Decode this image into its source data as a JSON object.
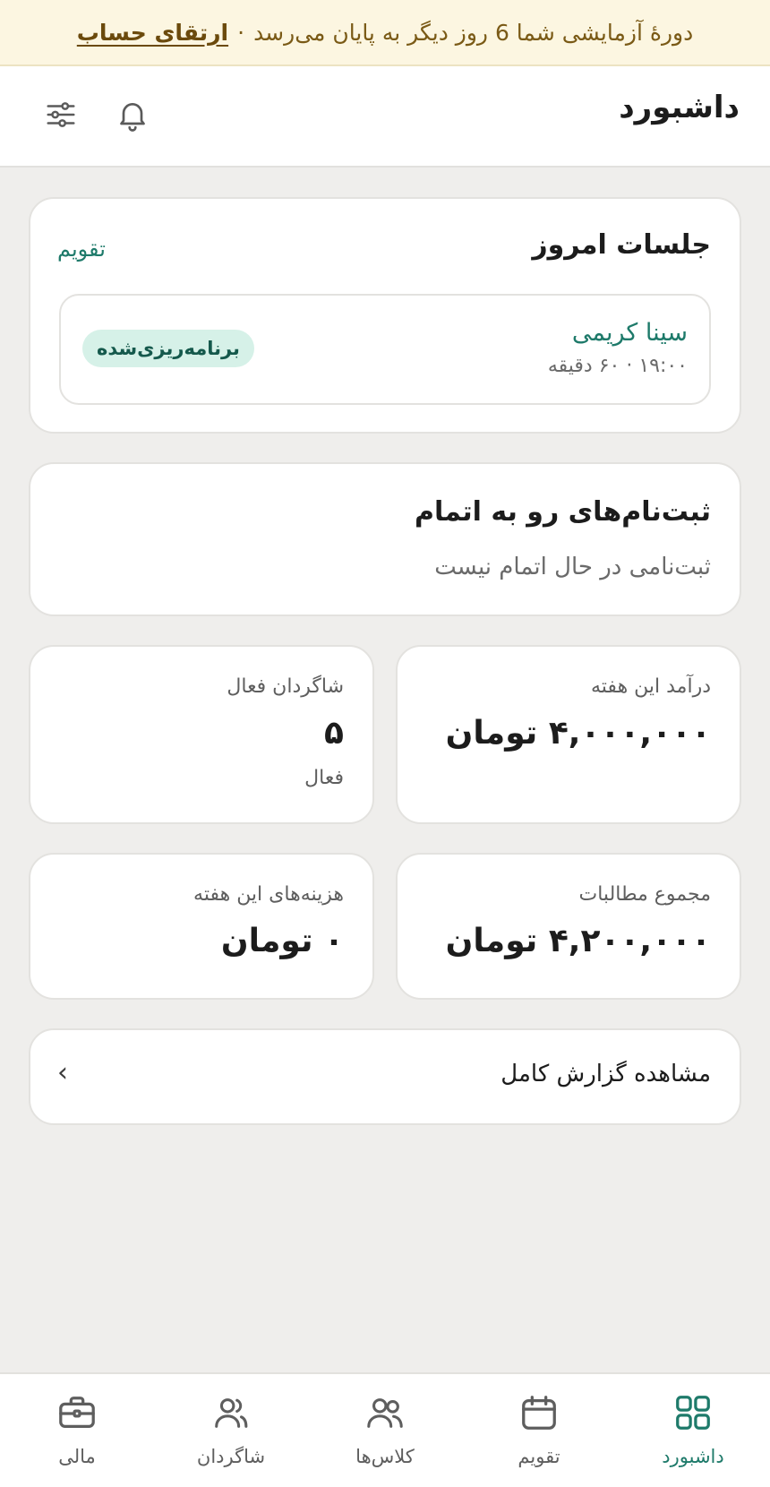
{
  "banner": {
    "message": "دورهٔ آزمایشی شما 6 روز دیگر به پایان می‌رسد",
    "separator": "·",
    "upgrade_link": "ارتقای حساب"
  },
  "header": {
    "title": "داشبورد"
  },
  "sessions": {
    "title": "جلسات امروز",
    "calendar_link": "تقویم",
    "items": [
      {
        "student": "سینا کریمی",
        "time_info": "۱۹:۰۰ · ۶۰ دقیقه",
        "status": "برنامه‌ریزی‌شده"
      }
    ]
  },
  "enrollments": {
    "title": "ثبت‌نام‌های رو به اتمام",
    "empty_text": "ثبت‌نامی در حال اتمام نیست"
  },
  "stats": {
    "income": {
      "label": "درآمد این هفته",
      "value": "۴,۰۰۰,۰۰۰ تومان"
    },
    "students": {
      "label": "شاگردان فعال",
      "value": "۵",
      "sub": "فعال"
    },
    "claims": {
      "label": "مجموع مطالبات",
      "value": "۴,۲۰۰,۰۰۰ تومان"
    },
    "expenses": {
      "label": "هزینه‌های این هفته",
      "value": "۰ تومان"
    }
  },
  "report": {
    "label": "مشاهده گزارش کامل",
    "chevron": "›"
  },
  "nav": {
    "items": [
      {
        "label": "داشبورد",
        "icon": "dashboard-icon",
        "active": true
      },
      {
        "label": "تقویم",
        "icon": "calendar-icon",
        "active": false
      },
      {
        "label": "کلاس‌ها",
        "icon": "classes-icon",
        "active": false
      },
      {
        "label": "شاگردان",
        "icon": "students-icon",
        "active": false
      },
      {
        "label": "مالی",
        "icon": "finance-icon",
        "active": false
      }
    ]
  },
  "colors": {
    "accent": "#1e7a6a",
    "banner_bg": "#fcf6e1",
    "banner_text": "#7a5a16",
    "badge_bg": "#d6f1e8",
    "page_bg": "#efeeec"
  }
}
